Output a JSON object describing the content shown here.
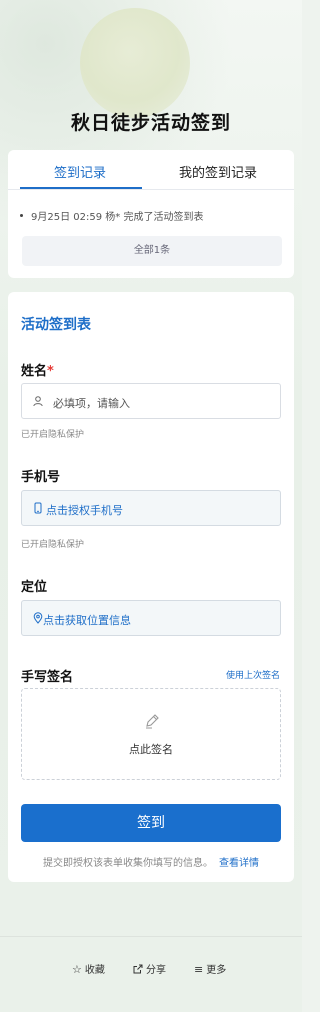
{
  "page": {
    "title": "秋日徒步活动签到"
  },
  "records": {
    "tabs": [
      {
        "label": "签到记录",
        "active": true
      },
      {
        "label": "我的签到记录",
        "active": false
      }
    ],
    "items": [
      {
        "time": "9月25日 02:59",
        "user": "杨*",
        "action": "完成了活动签到表"
      }
    ],
    "all_label": "全部1条"
  },
  "form": {
    "title": "活动签到表",
    "name": {
      "label": "姓名",
      "required_mark": "*",
      "placeholder": "必填项，请输入",
      "hint": "已开启隐私保护"
    },
    "phone": {
      "label": "手机号",
      "action": "点击授权手机号",
      "hint": "已开启隐私保护"
    },
    "location": {
      "label": "定位",
      "action": "点击获取位置信息"
    },
    "signature": {
      "label": "手写签名",
      "reuse": "使用上次签名",
      "placeholder": "点此签名"
    },
    "submit_label": "签到",
    "consent_text": "提交即授权该表单收集你填写的信息。",
    "consent_link": "查看详情"
  },
  "footer": {
    "items": [
      {
        "label": "收藏",
        "icon": "star-icon"
      },
      {
        "label": "分享",
        "icon": "share-icon"
      },
      {
        "label": "更多",
        "icon": "menu-icon"
      }
    ]
  },
  "colors": {
    "accent": "#1e6ec8",
    "button": "#1a6fcd",
    "required": "#e53935"
  }
}
